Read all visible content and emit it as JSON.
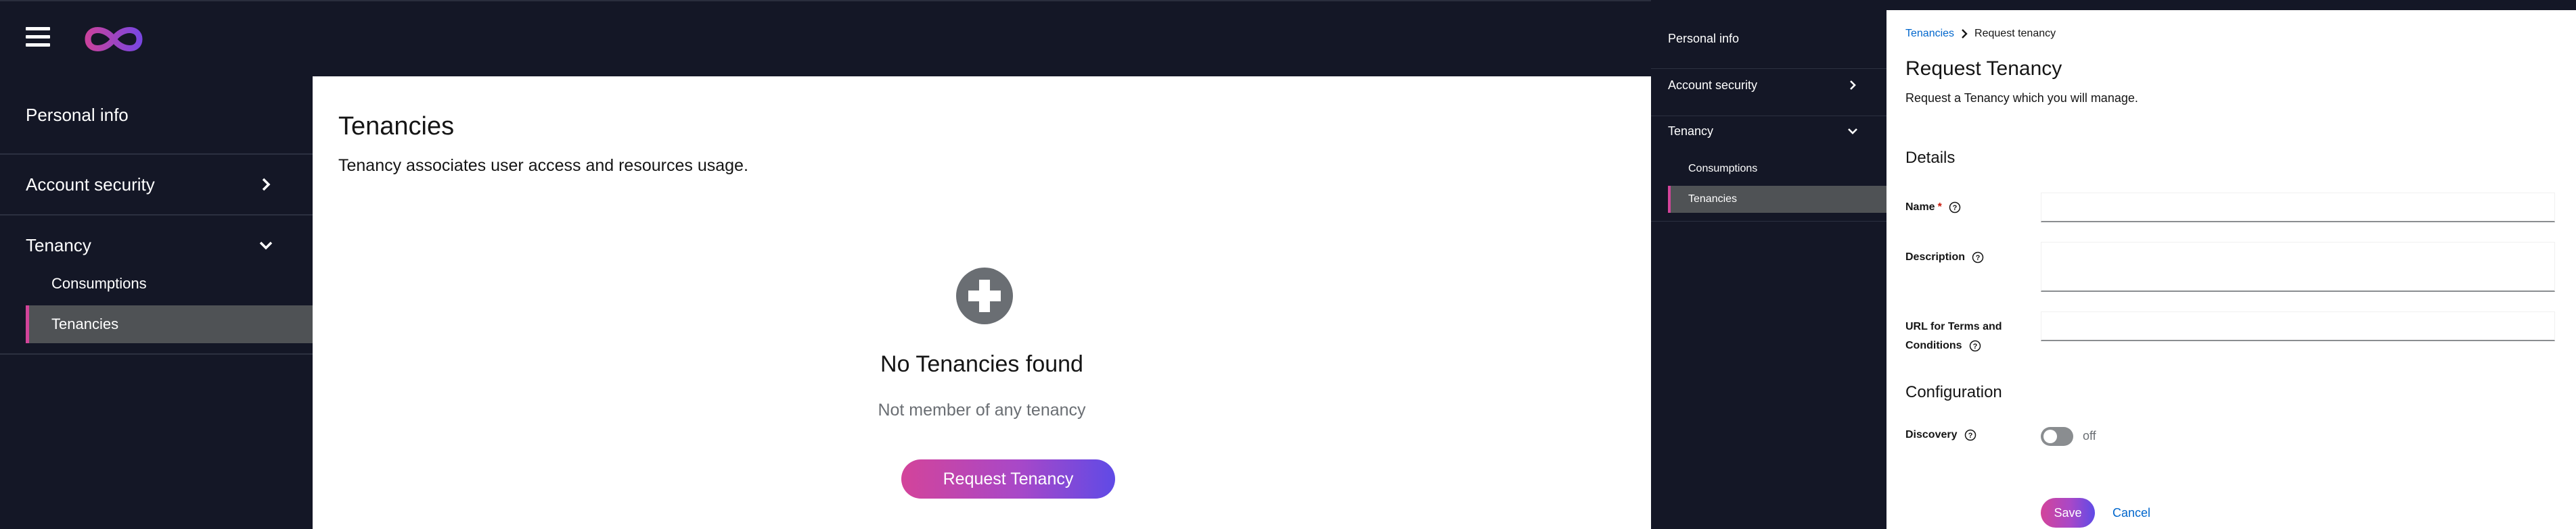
{
  "colors": {
    "dark_bg": "#141726",
    "accent_pink": "#d3449a",
    "accent_purple": "#5f4ae6",
    "link_blue": "#0066cc",
    "active_item_bg": "#4f5255"
  },
  "header": {
    "menu_icon": "hamburger-icon",
    "logo_icon": "infinity-logo"
  },
  "sidebar": {
    "personal_info": "Personal info",
    "account_security": "Account security",
    "tenancy": "Tenancy",
    "consumptions": "Consumptions",
    "tenancies": "Tenancies"
  },
  "main": {
    "title": "Tenancies",
    "description": "Tenancy associates user access and resources usage.",
    "empty_icon": "plus-circle-icon",
    "empty_title": "No Tenancies found",
    "empty_body": "Not member of any tenancy",
    "request_button": "Request Tenancy"
  },
  "form": {
    "breadcrumb": {
      "parent": "Tenancies",
      "current": "Request tenancy"
    },
    "title": "Request Tenancy",
    "description": "Request a Tenancy which you will manage.",
    "details_heading": "Details",
    "name_label": "Name",
    "required_mark": "*",
    "description_label": "Description",
    "url_label_line1": "URL for Terms and",
    "url_label_line2": "Conditions",
    "configuration_heading": "Configuration",
    "discovery_label": "Discovery",
    "discovery_state": "off",
    "name_value": "",
    "description_value": "",
    "url_value": "",
    "save_button": "Save",
    "cancel_button": "Cancel"
  }
}
